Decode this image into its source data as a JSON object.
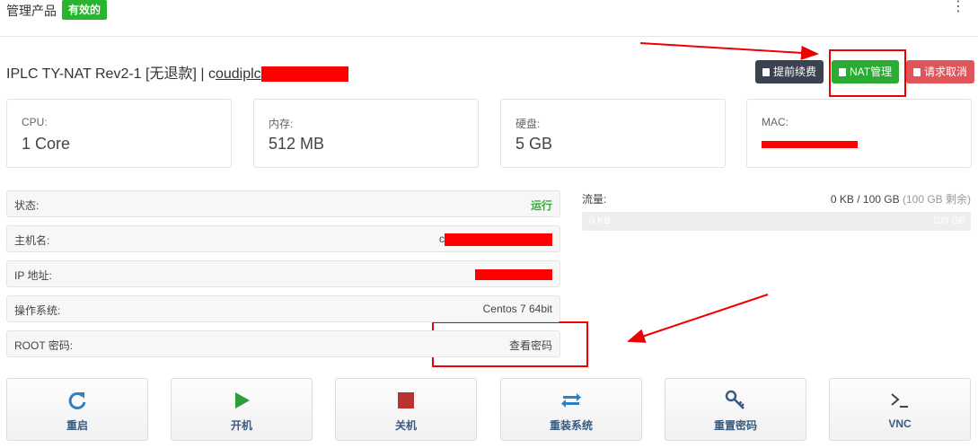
{
  "header": {
    "title": "管理产品",
    "status_badge": "有效的"
  },
  "product": {
    "name": "IPLC TY-NAT Rev2-1 [无退款] | c",
    "hostname_visible": "oudiplc"
  },
  "toolbar": {
    "renew_label": "提前续费",
    "nat_label": "NAT管理",
    "cancel_label": "请求取消"
  },
  "specs": [
    {
      "label": "CPU:",
      "value": "1 Core"
    },
    {
      "label": "内存:",
      "value": "512 MB"
    },
    {
      "label": "硬盘:",
      "value": "5 GB"
    },
    {
      "label": "MAC:",
      "value": ""
    }
  ],
  "details": [
    {
      "label": "状态:",
      "value": "运行"
    },
    {
      "label": "主机名:",
      "value": "c"
    },
    {
      "label": "IP 地址:",
      "value": ""
    },
    {
      "label": "操作系统:",
      "value": "Centos 7 64bit"
    },
    {
      "label": "ROOT 密码:",
      "value": "查看密码"
    }
  ],
  "traffic": {
    "label": "流量:",
    "used_total": "0 KB / 100 GB",
    "remaining": "(100 GB 剩余)",
    "bar_left": "0 KB",
    "bar_right": "100 GB",
    "used_fraction": 0
  },
  "actions": [
    {
      "label": "重启",
      "icon": "refresh-icon"
    },
    {
      "label": "开机",
      "icon": "play-icon"
    },
    {
      "label": "关机",
      "icon": "stop-icon"
    },
    {
      "label": "重装系统",
      "icon": "reinstall-icon"
    },
    {
      "label": "重置密码",
      "icon": "key-icon"
    },
    {
      "label": "VNC",
      "icon": "terminal-icon"
    }
  ],
  "colors": {
    "accent_blue": "#2f7fc1",
    "green": "#2bab33",
    "red": "#e0555a",
    "dark": "#3b4352",
    "stop_red": "#c0392b"
  }
}
